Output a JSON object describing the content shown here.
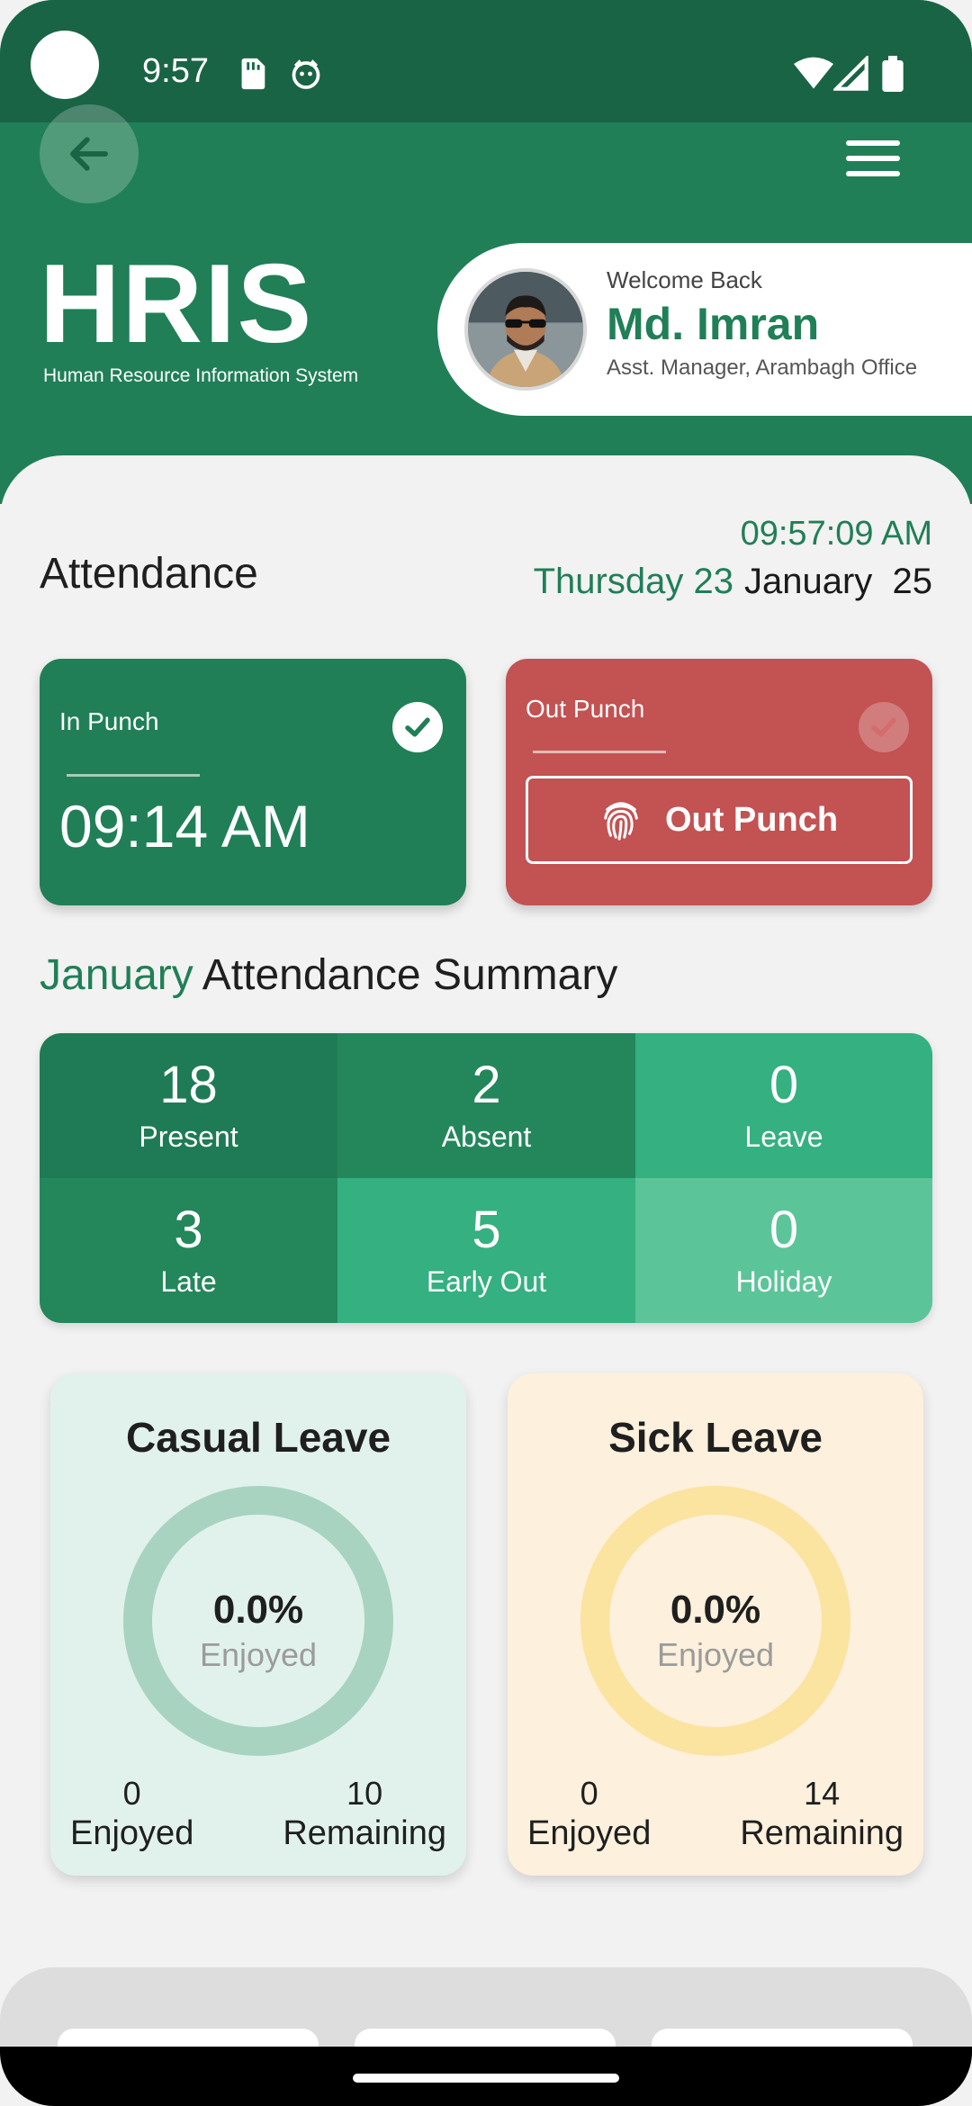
{
  "status_bar": {
    "time": "9:57"
  },
  "header": {
    "logo_text": "HRIS",
    "logo_subtitle": "Human Resource Information System",
    "welcome_label": "Welcome Back",
    "user_name": "Md. Imran",
    "user_role": "Asst. Manager, Arambagh Office"
  },
  "attendance": {
    "title": "Attendance",
    "clock": "09:57:09 AM",
    "day": "Thursday 23",
    "month_year": "January  25",
    "in_punch": {
      "label": "In Punch",
      "time": "09:14 AM"
    },
    "out_punch": {
      "label": "Out Punch",
      "button_label": "Out Punch"
    }
  },
  "summary": {
    "month": "January",
    "title_rest": "Attendance Summary",
    "cells": [
      {
        "value": "18",
        "label": "Present",
        "color": "#1f7b55"
      },
      {
        "value": "2",
        "label": "Absent",
        "color": "#24875c"
      },
      {
        "value": "0",
        "label": "Leave",
        "color": "#35b080"
      },
      {
        "value": "3",
        "label": "Late",
        "color": "#24875c"
      },
      {
        "value": "5",
        "label": "Early Out",
        "color": "#35b080"
      },
      {
        "value": "0",
        "label": "Holiday",
        "color": "#5cc499"
      }
    ]
  },
  "leaves": {
    "casual": {
      "title": "Casual Leave",
      "percent": "0.0%",
      "percent_label": "Enjoyed",
      "enjoyed": "0",
      "enjoyed_label": "Enjoyed",
      "remaining": "10",
      "remaining_label": "Remaining",
      "ring_color": "#a8d3c0"
    },
    "sick": {
      "title": "Sick Leave",
      "percent": "0.0%",
      "percent_label": "Enjoyed",
      "enjoyed": "0",
      "enjoyed_label": "Enjoyed",
      "remaining": "14",
      "remaining_label": "Remaining",
      "ring_color": "#fbe3a0"
    }
  },
  "colors": {
    "primary": "#207f57",
    "danger": "#c35252"
  }
}
